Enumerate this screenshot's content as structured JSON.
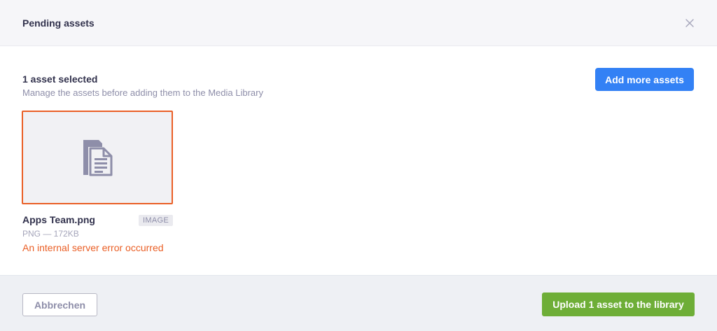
{
  "modal": {
    "title": "Pending assets",
    "close_icon": "close-icon"
  },
  "section": {
    "title": "1 asset selected",
    "subtitle": "Manage the assets before adding them to the Media Library",
    "add_more_label": "Add more assets"
  },
  "assets": [
    {
      "name": "Apps Team.png",
      "badge": "IMAGE",
      "meta": "PNG — 172KB",
      "error": "An internal server error occurred",
      "icon": "document-icon"
    }
  ],
  "footer": {
    "cancel_label": "Abbrechen",
    "upload_label": "Upload 1 asset to the library"
  },
  "colors": {
    "primary": "#3381f5",
    "success": "#6eae37",
    "error": "#ea5f26",
    "header_bg": "#f6f6f9",
    "footer_bg": "#eef0f4"
  }
}
